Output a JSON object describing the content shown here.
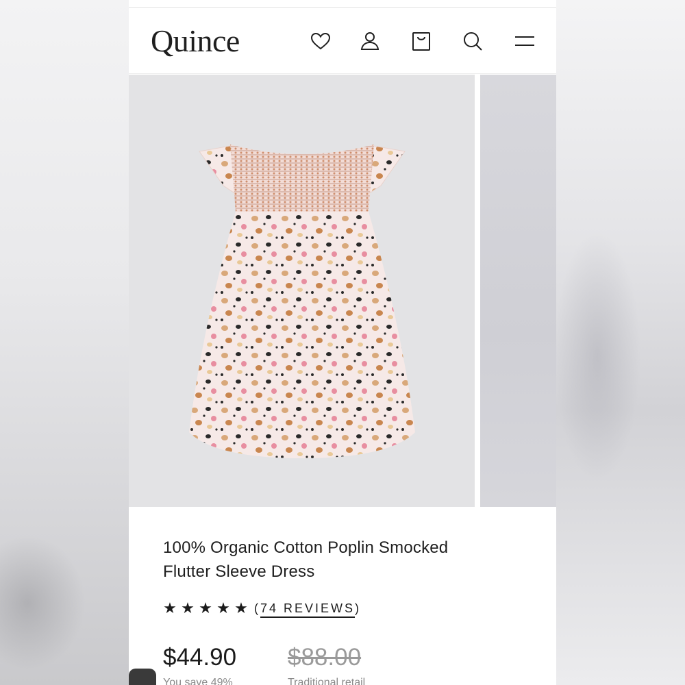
{
  "header": {
    "logo": "Quince",
    "icons": [
      "heart-icon",
      "user-icon",
      "bag-icon",
      "search-icon",
      "menu-icon"
    ]
  },
  "product": {
    "title_line1": "100% Organic Cotton Poplin Smocked",
    "title_line2": "Flutter Sleeve Dress",
    "rating": 5,
    "reviews_open": "(",
    "reviews_count": "74 REVIEWS",
    "reviews_close": ")",
    "price": "$44.90",
    "old_price": "$88.00",
    "savings": "You save 49%",
    "retail_label": "Traditional retail"
  },
  "colors": {
    "text": "#1b1b1b",
    "muted": "#9a9a9a",
    "image_bg": "#e3e3e5"
  }
}
